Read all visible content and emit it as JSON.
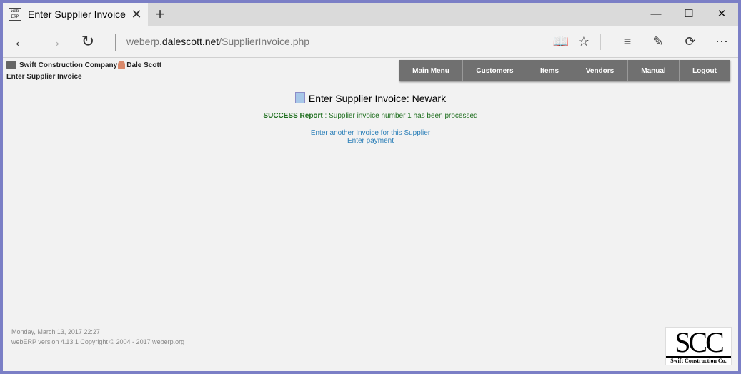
{
  "browser": {
    "tab_title": "Enter Supplier Invoice",
    "favicon_text": "web ERP",
    "url_prefix": "weberp.",
    "url_domain": "dalescott.net",
    "url_path": "/SupplierInvoice.php"
  },
  "header": {
    "company": "Swift Construction Company",
    "user": "Dale Scott",
    "page_title": "Enter Supplier Invoice"
  },
  "menu": {
    "items": [
      {
        "label": "Main Menu"
      },
      {
        "label": "Customers"
      },
      {
        "label": "Items"
      },
      {
        "label": "Vendors"
      },
      {
        "label": "Manual"
      },
      {
        "label": "Logout"
      }
    ]
  },
  "main": {
    "heading": "Enter Supplier Invoice: Newark",
    "success_label": "SUCCESS Report",
    "success_message": " : Supplier invoice number 1 has been processed",
    "link_another_invoice": "Enter another Invoice for this Supplier",
    "link_payment": "Enter payment"
  },
  "footer": {
    "datetime": "Monday, March 13, 2017 22:27",
    "version": "webERP version 4.13.1 Copyright © 2004 - 2017 ",
    "site_link": "weberp.org"
  },
  "logo": {
    "big": "SCC",
    "small": "Swift Construction Co."
  },
  "icons": {
    "close": "close-icon",
    "plus": "new-tab-icon",
    "back": "back-arrow-icon",
    "forward": "forward-arrow-icon",
    "refresh": "refresh-icon"
  }
}
